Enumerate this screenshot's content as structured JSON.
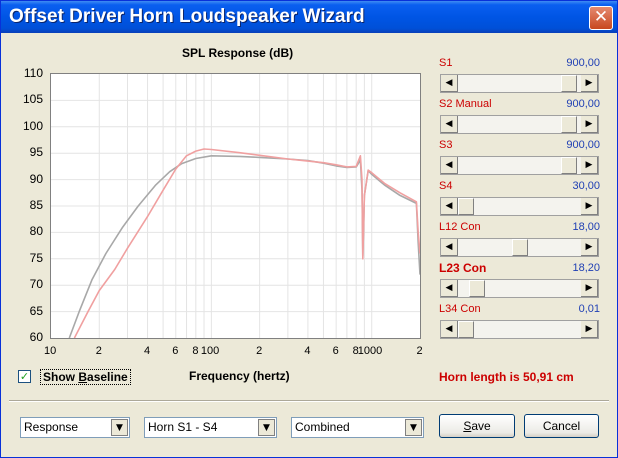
{
  "window": {
    "title": "Offset Driver Horn Loudspeaker Wizard",
    "close_glyph": "✕"
  },
  "chart_data": {
    "type": "line",
    "title": "SPL Response (dB)",
    "xlabel": "Frequency (hertz)",
    "ylabel": "",
    "x_scale": "log",
    "xlim": [
      10,
      2000
    ],
    "ylim": [
      60,
      110
    ],
    "y_ticks": [
      "110",
      "105",
      "100",
      "95",
      "90",
      "85",
      "80",
      "75",
      "70",
      "65",
      "60"
    ],
    "x_tick_labels": [
      "10",
      "2",
      "4",
      "6",
      "8",
      "100",
      "2",
      "4",
      "6",
      "8",
      "1000",
      "2"
    ],
    "grid": true,
    "series": [
      {
        "color": "#a8a8a8",
        "x": [
          13,
          15,
          18,
          22,
          28,
          35,
          45,
          55,
          65,
          80,
          100,
          150,
          200,
          300,
          400,
          500,
          600,
          700,
          800,
          850,
          870,
          880,
          900,
          950,
          1000,
          1200,
          1500,
          1900,
          1950,
          2000
        ],
        "y": [
          60,
          65,
          71,
          76,
          81,
          85,
          89,
          91.5,
          93,
          94,
          94.5,
          94.4,
          94.2,
          93.9,
          93.6,
          93.1,
          92.6,
          92.3,
          92.4,
          93.7,
          88,
          75.5,
          87,
          91.7,
          91,
          89,
          87,
          85.5,
          78,
          72
        ]
      },
      {
        "color": "#f0a0a0",
        "x": [
          14,
          17,
          20,
          25,
          30,
          40,
          50,
          60,
          70,
          80,
          90,
          100,
          150,
          200,
          300,
          400,
          500,
          600,
          700,
          800,
          850,
          870,
          880,
          900,
          950,
          1000,
          1200,
          1500,
          1900,
          1950,
          2000
        ],
        "y": [
          60,
          65,
          69,
          73,
          77,
          83,
          88,
          92,
          94.5,
          95.4,
          95.8,
          95.7,
          95.1,
          94.6,
          93.9,
          93.5,
          93.2,
          92.8,
          92.4,
          92.5,
          94.5,
          90,
          75,
          87,
          91.8,
          91.3,
          89.3,
          87.5,
          85.8,
          80,
          76
        ]
      }
    ]
  },
  "baseline": {
    "checked_glyph": "✓",
    "label_pre": "Show ",
    "label_u": "B",
    "label_post": "aseline"
  },
  "params": [
    {
      "label": "S1",
      "value": "900,00",
      "level": 0.96,
      "bold": false
    },
    {
      "label": "S2 Manual",
      "value": "900,00",
      "level": 0.96,
      "bold": false
    },
    {
      "label": "S3",
      "value": "900,00",
      "level": 0.96,
      "bold": false
    },
    {
      "label": "S4",
      "value": "30,00",
      "level": 0.0,
      "bold": false
    },
    {
      "label": "L12 Con",
      "value": "18,00",
      "level": 0.5,
      "bold": false
    },
    {
      "label": "L23 Con",
      "value": "18,20",
      "level": 0.1,
      "bold": true
    },
    {
      "label": "L34 Con",
      "value": "0,01",
      "level": 0.0,
      "bold": false
    }
  ],
  "scroll_left": "◀",
  "scroll_right": "▶",
  "horn_length": "Horn length is 50,91 cm",
  "combos": [
    {
      "value": "Response"
    },
    {
      "value": "Horn S1 - S4"
    },
    {
      "value": "Combined"
    }
  ],
  "combo_arrow": "▼",
  "buttons": {
    "save_pre": "",
    "save_u": "S",
    "save_post": "ave",
    "cancel": "Cancel"
  }
}
